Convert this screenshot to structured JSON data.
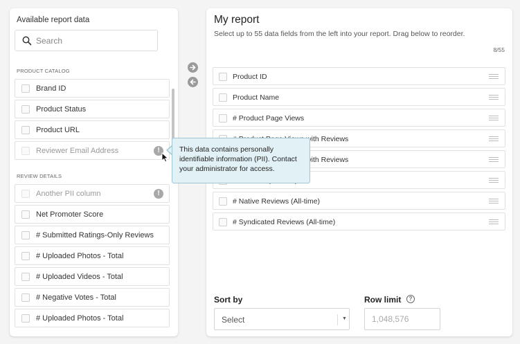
{
  "left_panel": {
    "title": "Available report data",
    "search_placeholder": "Search",
    "sections": [
      {
        "label": "PRODUCT CATALOG",
        "items": [
          {
            "label": "Brand ID",
            "disabled": false
          },
          {
            "label": "Product Status",
            "disabled": false
          },
          {
            "label": "Product URL",
            "disabled": false
          },
          {
            "label": "Reviewer Email Address",
            "disabled": true,
            "warning_icon": "!"
          }
        ]
      },
      {
        "label": "REVIEW DETAILS",
        "items": [
          {
            "label": "Another PII column",
            "disabled": true,
            "warning_icon": "!"
          },
          {
            "label": "Net Promoter Score",
            "disabled": false
          },
          {
            "label": "# Submitted Ratings-Only Reviews",
            "disabled": false
          },
          {
            "label": "# Uploaded Photos - Total",
            "disabled": false
          },
          {
            "label": "# Uploaded Videos - Total",
            "disabled": false
          },
          {
            "label": "# Negative Votes - Total",
            "disabled": false
          },
          {
            "label": "# Uploaded Photos - Total",
            "disabled": false
          }
        ]
      }
    ]
  },
  "tooltip": {
    "text": "This data contains personally identifiable information (PII). Contact your administrator for access."
  },
  "transfer": {
    "add_icon": "arrow-right-icon",
    "remove_icon": "arrow-left-icon"
  },
  "right_panel": {
    "title": "My report",
    "subtitle": "Select up to 55 data fields from the left into your report. Drag below to reorder.",
    "count": "8/55",
    "items": [
      "Product ID",
      "Product Name",
      "# Product Page Views",
      "# Product Page Views with Reviews",
      "# Product Page Views with Reviews",
      "# Reviews (All-time)",
      "# Native Reviews (All-time)",
      "# Syndicated Reviews (All-time)"
    ],
    "sort_by": {
      "label": "Sort by",
      "value": "Select"
    },
    "row_limit": {
      "label": "Row limit",
      "placeholder": "1,048,576",
      "help_icon": "?"
    }
  },
  "colors": {
    "tooltip_bg": "#e2f1f5",
    "tooltip_border": "#9cc7d2",
    "warning": "#a8a8a8"
  }
}
